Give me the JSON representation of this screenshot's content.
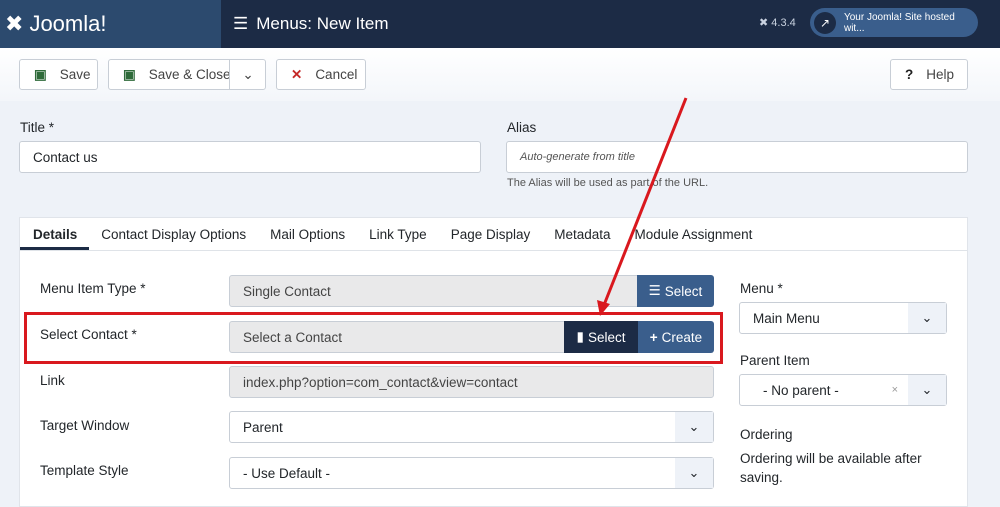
{
  "header": {
    "logo": "Joomla!",
    "title": "Menus: New Item",
    "version": "4.3.4",
    "site_link": "Your Joomla! Site hosted wit..."
  },
  "toolbar": {
    "save": "Save",
    "save_close": "Save & Close",
    "cancel": "Cancel",
    "help": "Help"
  },
  "form": {
    "title_label": "Title *",
    "title_value": "Contact us",
    "alias_label": "Alias",
    "alias_placeholder": "Auto-generate from title",
    "alias_hint": "The Alias will be used as part of the URL."
  },
  "tabs": [
    "Details",
    "Contact Display Options",
    "Mail Options",
    "Link Type",
    "Page Display",
    "Metadata",
    "Module Assignment"
  ],
  "details": {
    "menu_item_type_label": "Menu Item Type *",
    "menu_item_type_value": "Single Contact",
    "type_select": "Select",
    "select_contact_label": "Select Contact *",
    "select_contact_value": "Select a Contact",
    "contact_select": "Select",
    "contact_create": "Create",
    "link_label": "Link",
    "link_value": "index.php?option=com_contact&view=contact",
    "target_label": "Target Window",
    "target_value": "Parent",
    "template_label": "Template Style",
    "template_value": "- Use Default -"
  },
  "side": {
    "menu_label": "Menu *",
    "menu_value": "Main Menu",
    "parent_label": "Parent Item",
    "parent_value": "- No parent -",
    "ordering_label": "Ordering",
    "ordering_text": "Ordering will be available after saving."
  },
  "colors": {
    "header": "#1c2b45",
    "logo_bg": "#2c4a6e",
    "primary": "#3a5e8c",
    "annotation": "#d9181e"
  }
}
